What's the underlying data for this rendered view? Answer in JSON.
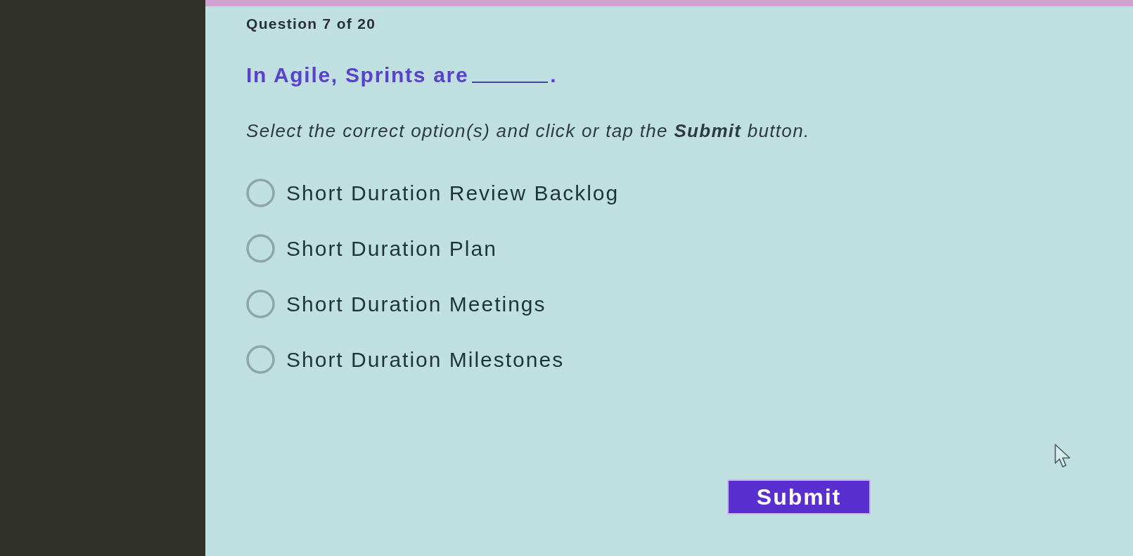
{
  "progress": {
    "label": "Question 7 of 20"
  },
  "question": {
    "text_before_blank": "In Agile, Sprints are",
    "text_after_blank": "."
  },
  "instruction": "Select the correct option(s) and click or tap the **Submit** button.",
  "options": [
    {
      "label": "Short Duration Review Backlog",
      "selected": false
    },
    {
      "label": "Short Duration Plan",
      "selected": false
    },
    {
      "label": "Short Duration Meetings",
      "selected": false
    },
    {
      "label": "Short Duration Milestones",
      "selected": false
    }
  ],
  "submit_button": {
    "label": "Submit"
  }
}
